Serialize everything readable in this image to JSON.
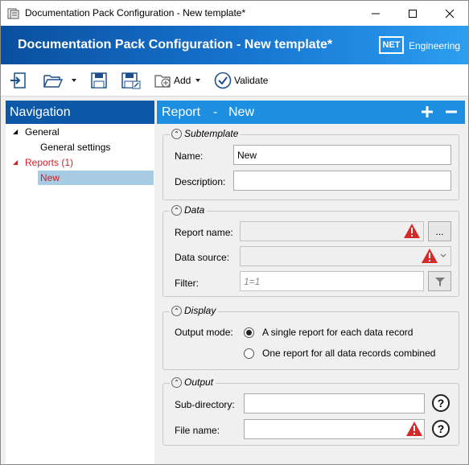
{
  "window": {
    "title": "Documentation Pack Configuration - New template*"
  },
  "banner": {
    "title": "Documentation Pack Configuration - New template*",
    "logo_mark": "NET",
    "logo_text": "Engineering"
  },
  "toolbar": {
    "add_label": "Add",
    "validate_label": "Validate"
  },
  "navigation": {
    "header": "Navigation",
    "tree": [
      {
        "label": "General",
        "expanded": true
      },
      {
        "label": "General settings"
      },
      {
        "label": "Reports (1)",
        "expanded": true,
        "color": "#d0202a"
      },
      {
        "label": "New",
        "selected": true,
        "color": "#d0202a"
      }
    ]
  },
  "main": {
    "header_type": "Report",
    "header_sep": "-",
    "header_name": "New",
    "subtemplate": {
      "title": "Subtemplate",
      "name_label": "Name:",
      "name_value": "New",
      "description_label": "Description:",
      "description_value": ""
    },
    "data": {
      "title": "Data",
      "report_name_label": "Report name:",
      "report_name_value": "",
      "browse_label": "...",
      "data_source_label": "Data source:",
      "data_source_value": "",
      "filter_label": "Filter:",
      "filter_placeholder": "1=1"
    },
    "display": {
      "title": "Display",
      "output_mode_label": "Output mode:",
      "options": [
        {
          "label": "A single report for each data record",
          "checked": true
        },
        {
          "label": "One report for all data records combined",
          "checked": false
        }
      ]
    },
    "output": {
      "title": "Output",
      "subdir_label": "Sub-directory:",
      "subdir_value": "",
      "filename_label": "File name:",
      "filename_value": ""
    }
  },
  "colors": {
    "nav_header": "#0e58a8",
    "main_header": "#1e8fe0",
    "selected_row": "#a8cbe4",
    "accent_red": "#d0202a",
    "warning": "#d42a2a"
  }
}
